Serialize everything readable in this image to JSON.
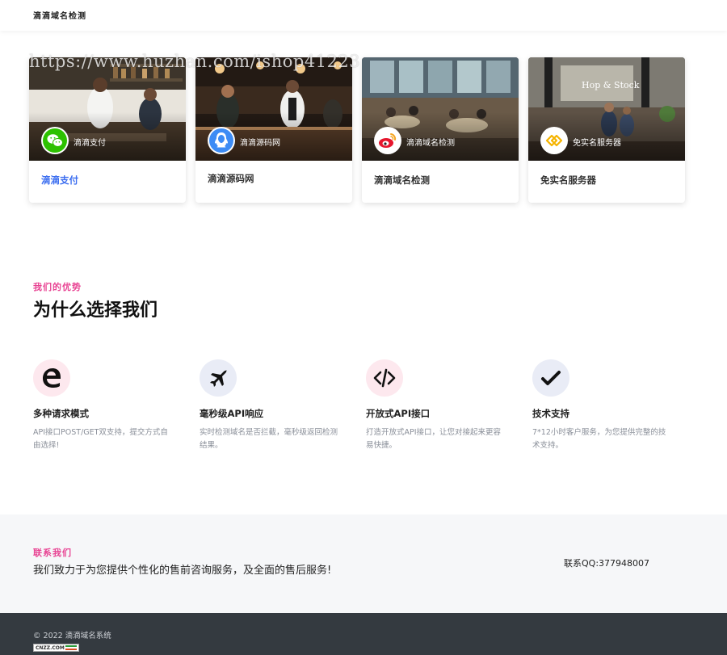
{
  "header": {
    "logo": "滴滴域名检测"
  },
  "watermark": "https://www.huzhan.com/ishop41223",
  "cards": [
    {
      "label": "滴滴支付",
      "title": "滴滴支付",
      "icon": "wechat-icon",
      "active": true
    },
    {
      "label": "滴滴源码网",
      "title": "滴滴源码网",
      "icon": "qq-icon",
      "active": false
    },
    {
      "label": "滴滴域名检测",
      "title": "滴滴域名检测",
      "icon": "weibo-icon",
      "active": false
    },
    {
      "label": "免实名服务器",
      "title": "免实名服务器",
      "icon": "link-icon",
      "active": false
    }
  ],
  "advantages": {
    "subtitle": "我们的优势",
    "title": "为什么选择我们",
    "features": [
      {
        "title": "多种请求模式",
        "desc": "API接口POST/GET双支持，提交方式自由选择!",
        "icon": "edge-icon"
      },
      {
        "title": "毫秒级API响应",
        "desc": "实时检测域名是否拦截，毫秒级返回检测结果。",
        "icon": "plane-icon"
      },
      {
        "title": "开放式API接口",
        "desc": "打造开放式API接口，让您对接起来更容易快捷。",
        "icon": "code-icon"
      },
      {
        "title": "技术支持",
        "desc": "7*12小时客户服务，为您提供完整的技术支持。",
        "icon": "check-icon"
      }
    ]
  },
  "contact": {
    "subtitle": "联系我们",
    "text": "我们致力于为您提供个性化的售前咨询服务，及全面的售后服务!",
    "qq": "联系QQ:377948007"
  },
  "footer": {
    "copyright": "© 2022 滴滴域名系统",
    "badge": "CNZZ.COM"
  },
  "colors": {
    "accent": "#e84393",
    "link": "#3c6ef0",
    "footer_bg": "#343a40",
    "contact_bg": "#f6f7f9"
  }
}
